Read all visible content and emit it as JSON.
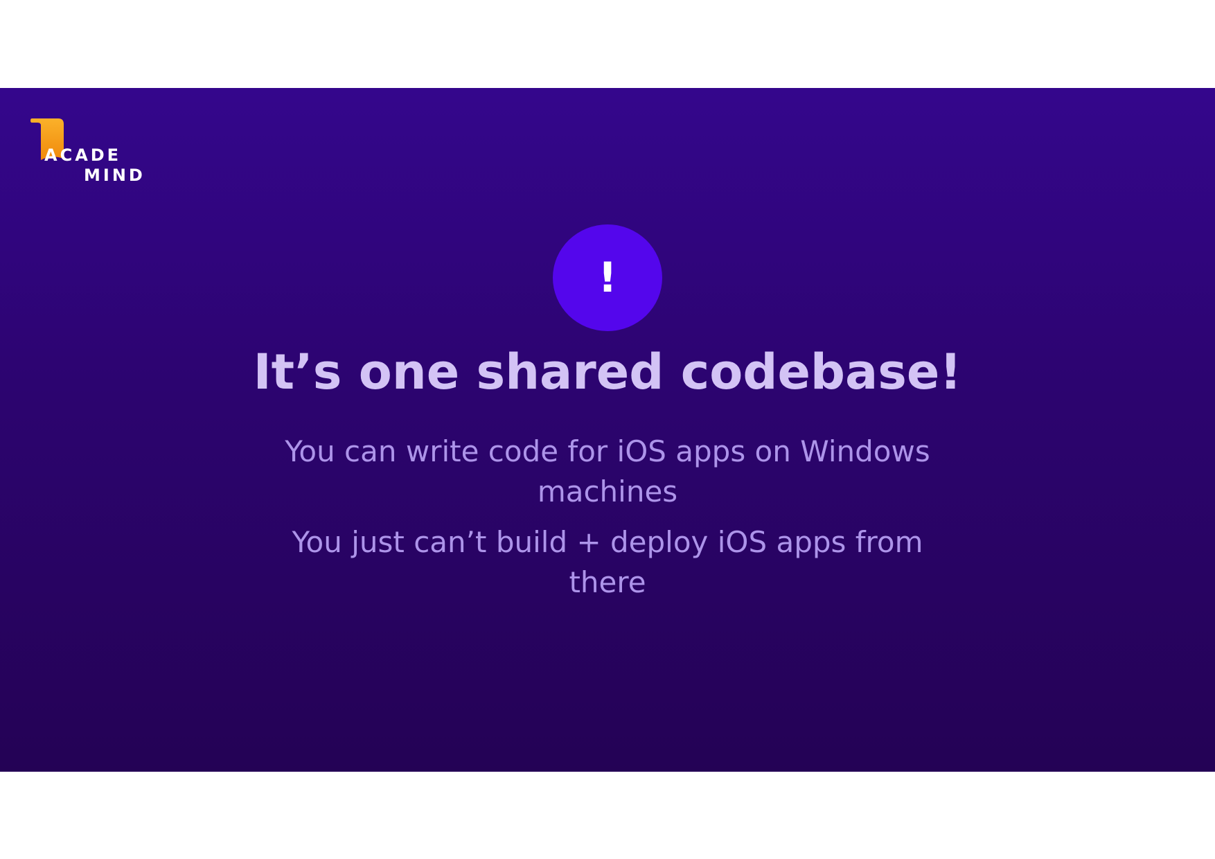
{
  "logo": {
    "line1": "ACADE",
    "line2": "MIND",
    "accent": "#f7a51c"
  },
  "badge": {
    "glyph": "!",
    "icon": "exclamation-icon",
    "color": "#5406ec"
  },
  "title": "It’s one shared codebase!",
  "paragraphs": [
    "You can write code for iOS apps on Windows machines",
    "You just can’t build + deploy iOS apps from there"
  ],
  "colors": {
    "background_top": "#34068c",
    "background_bottom": "#240255",
    "title": "#d3c3f5",
    "body": "#ad94ea"
  }
}
